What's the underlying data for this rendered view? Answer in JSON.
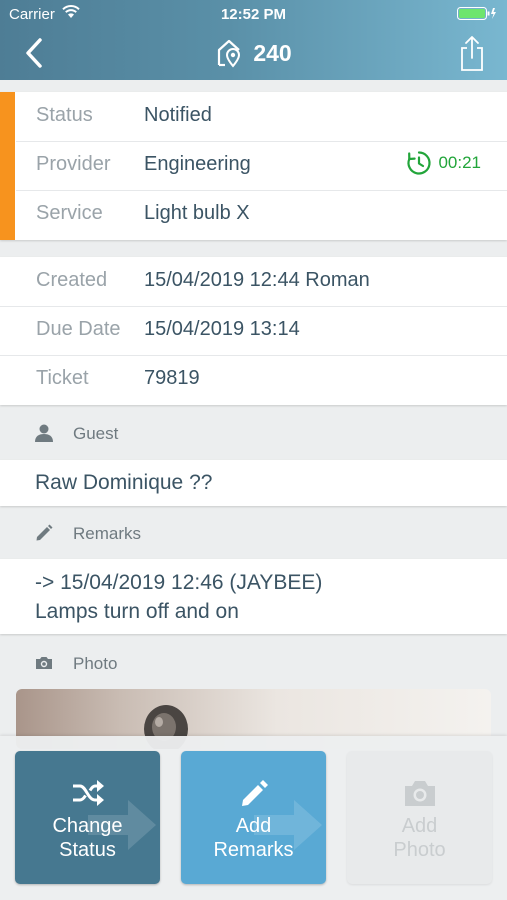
{
  "status_bar": {
    "carrier": "Carrier",
    "time": "12:52 PM"
  },
  "nav": {
    "title": "240",
    "back_icon": "chevron-left-icon",
    "location_icon": "home-location-icon",
    "share_icon": "share-icon"
  },
  "details": {
    "status_label": "Status",
    "status_value": "Notified",
    "provider_label": "Provider",
    "provider_value": "Engineering",
    "timer_value": "00:21",
    "service_label": "Service",
    "service_value": "Light bulb X",
    "accent_color": "#f7931e"
  },
  "meta": {
    "created_label": "Created",
    "created_value": "15/04/2019 12:44 Roman",
    "due_label": "Due Date",
    "due_value": "15/04/2019 13:14",
    "ticket_label": "Ticket",
    "ticket_value": "79819"
  },
  "guest": {
    "header": "Guest",
    "name": "Raw Dominique ??"
  },
  "remarks": {
    "header": "Remarks",
    "line1": "-> 15/04/2019 12:46 (JAYBEE)",
    "line2": "Lamps turn off and on"
  },
  "photo": {
    "header": "Photo"
  },
  "actions": [
    {
      "line1": "Change",
      "line2": "Status",
      "color": "#467890",
      "enabled": true
    },
    {
      "line1": "Add",
      "line2": "Remarks",
      "color": "#59a9d4",
      "enabled": true
    },
    {
      "line1": "Add",
      "line2": "Photo",
      "color": "#e8eaeb",
      "enabled": false
    }
  ]
}
